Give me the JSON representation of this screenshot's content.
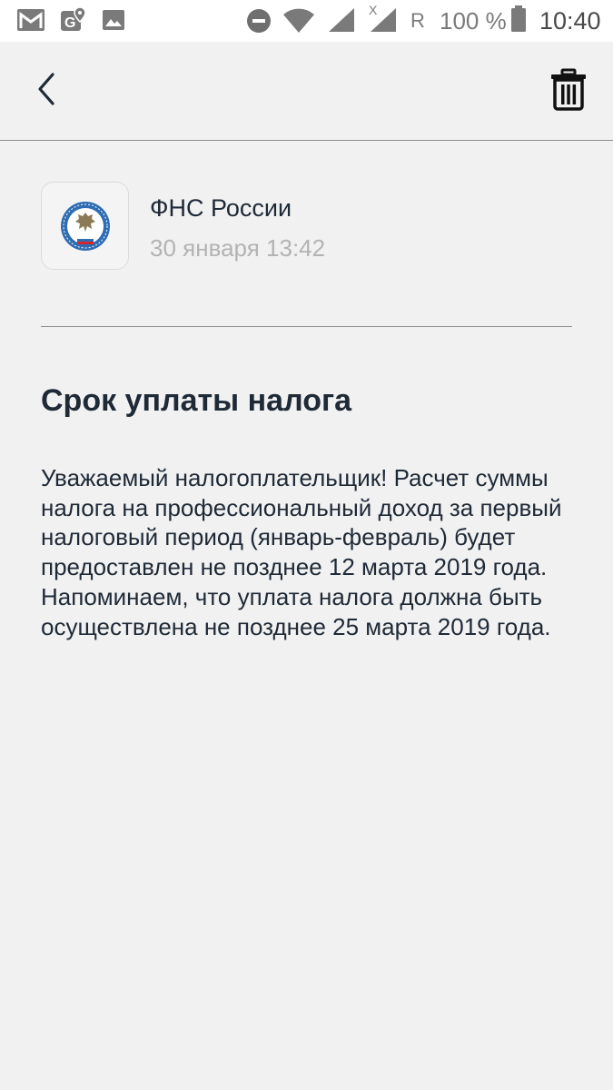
{
  "status_bar": {
    "icons": [
      "gmail-icon",
      "maps-notification-icon",
      "gallery-icon",
      "do-not-disturb-icon",
      "wifi-icon",
      "signal-icon",
      "no-signal-icon",
      "battery-icon"
    ],
    "roaming": "R",
    "battery": "100 %",
    "time": "10:40"
  },
  "toolbar": {
    "back_icon": "chevron-left-icon",
    "delete_icon": "trash-icon"
  },
  "message": {
    "sender": "ФНС России",
    "date": "30 января 13:42",
    "title": "Срок уплаты налога",
    "body": "Уважаемый налогоплательщик! Расчет суммы налога на профессиональный доход за первый налоговый период (январь-февраль) будет предоставлен не позднее 12 марта 2019 года. Напоминаем, что уплата налога должна быть осуществлена не позднее 25 марта 2019 года."
  },
  "colors": {
    "background": "#f1f1f1",
    "text": "#1f2a37",
    "muted": "#b3b3b3"
  }
}
